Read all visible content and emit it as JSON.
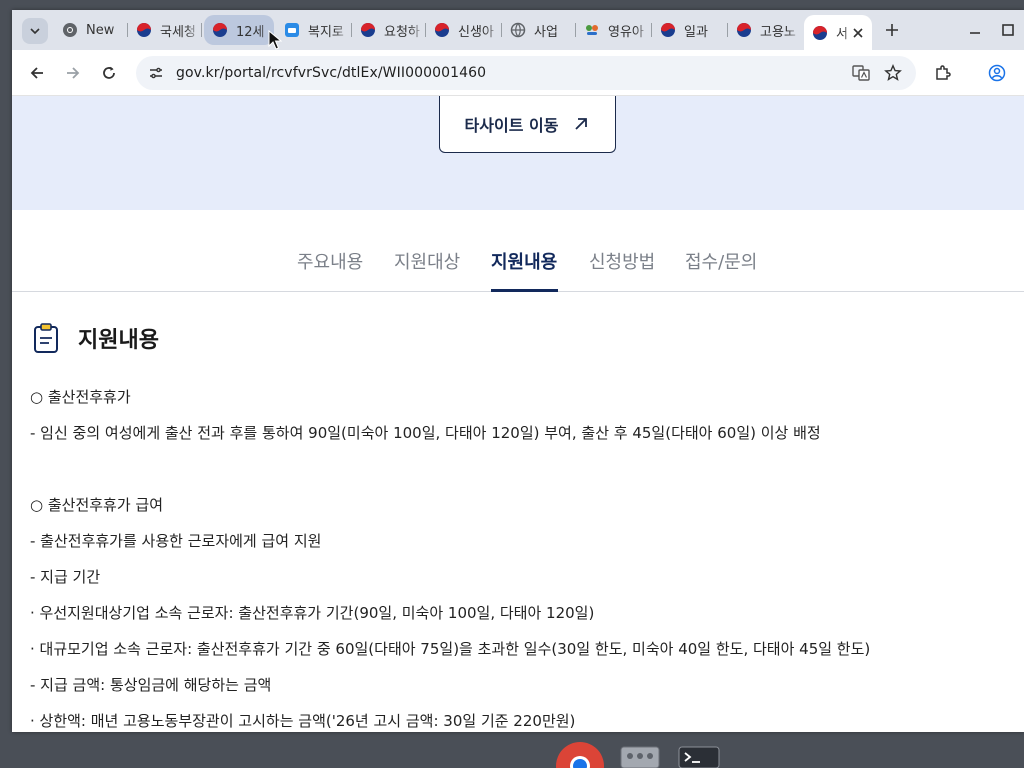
{
  "browser": {
    "tabs": [
      {
        "title": "New"
      },
      {
        "title": "국세청"
      },
      {
        "title": "12세"
      },
      {
        "title": "복지로"
      },
      {
        "title": "요청하"
      },
      {
        "title": "신생아"
      },
      {
        "title": "사업"
      },
      {
        "title": "영유아"
      },
      {
        "title": "일과"
      },
      {
        "title": "고용노"
      },
      {
        "title": "서"
      }
    ],
    "url": "gov.kr/portal/rcvfvrSvc/dtlEx/WII000001460"
  },
  "hero": {
    "external_button_label": "타사이트 이동"
  },
  "nav_tabs": [
    {
      "label": "주요내용"
    },
    {
      "label": "지원대상"
    },
    {
      "label": "지원내용"
    },
    {
      "label": "신청방법"
    },
    {
      "label": "접수/문의"
    }
  ],
  "section": {
    "title": "지원내용",
    "lines": [
      "○ 출산전후휴가",
      "- 임신 중의 여성에게 출산 전과 후를 통하여 90일(미숙아 100일, 다태아 120일) 부여, 출산 후 45일(다태아 60일) 이상 배정",
      "○ 출산전후휴가 급여",
      "- 출산전후휴가를 사용한 근로자에게 급여 지원",
      "- 지급 기간",
      "· 우선지원대상기업 소속 근로자: 출산전후휴가 기간(90일, 미숙아 100일, 다태아 120일)",
      "· 대규모기업 소속 근로자: 출산전후휴가 기간 중 60일(다태아 75일)을 초과한 일수(30일 한도, 미숙아 40일 한도, 다태아 45일 한도)",
      "- 지급 금액: 통상임금에 해당하는 금액",
      "· 상한액: 매년 고용노동부장관이 고시하는 금액('26년 고시 금액: 30일 기준 220만원)"
    ]
  },
  "colors": {
    "accent": "#12295c",
    "hero_background": "#e6ecfa",
    "tab_strip": "#dfe3eb"
  }
}
